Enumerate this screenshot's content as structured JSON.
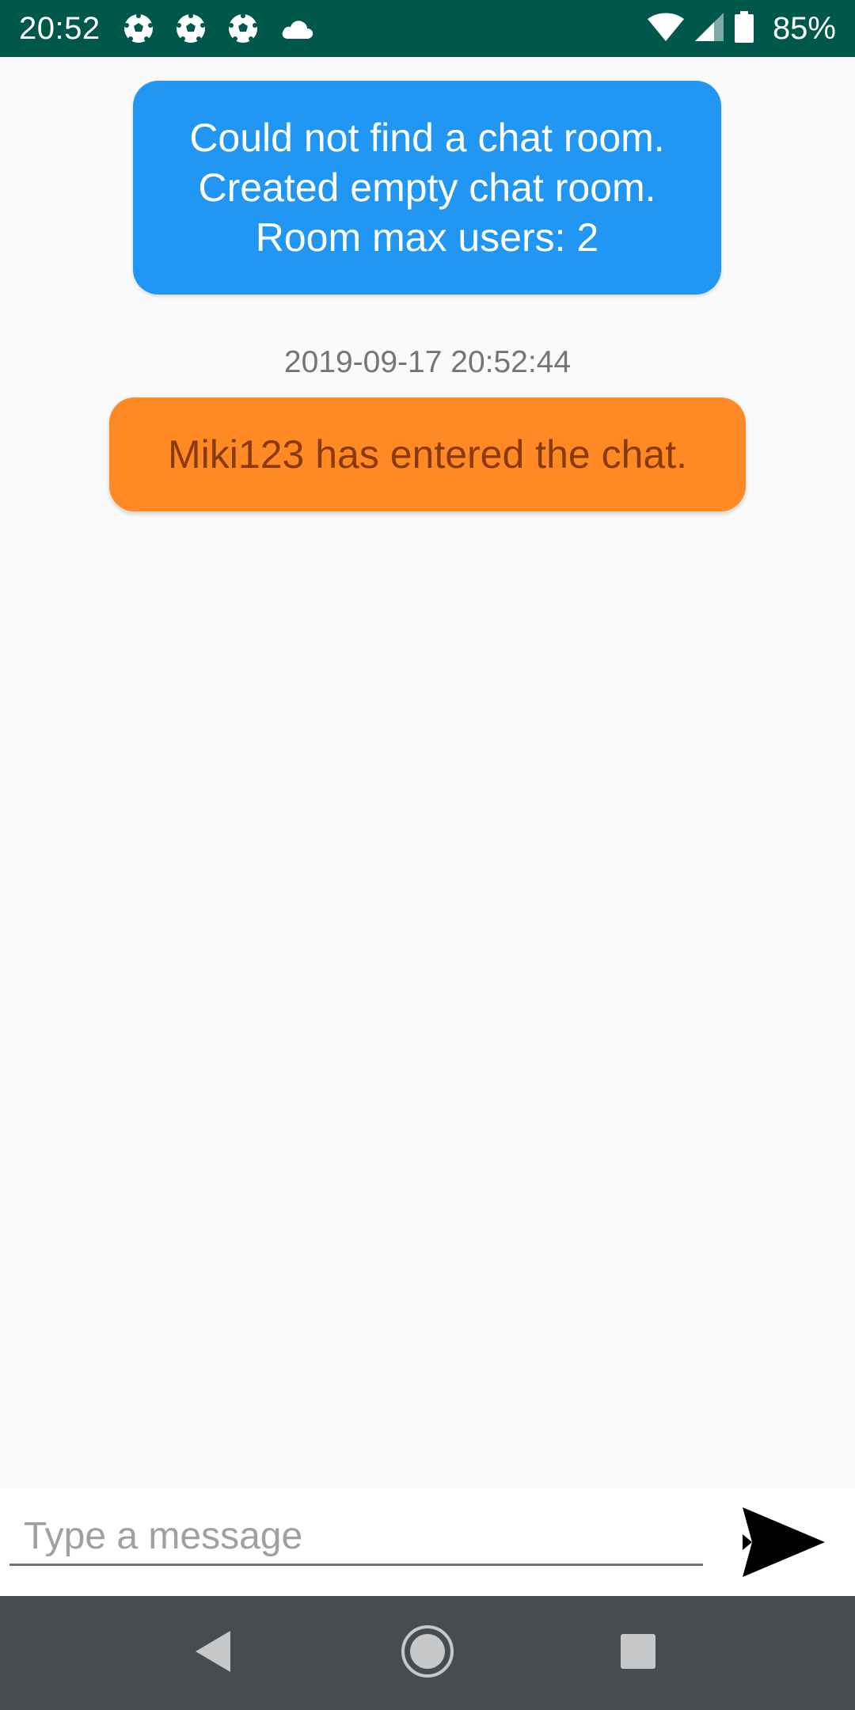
{
  "status_bar": {
    "time": "20:52",
    "battery": "85%",
    "left_icons": [
      "soccer-ball-icon",
      "soccer-ball-icon",
      "soccer-ball-icon",
      "cloud-icon"
    ],
    "right_icons": [
      "wifi-icon",
      "cell-signal-icon",
      "battery-icon"
    ],
    "background_color": "#00574b"
  },
  "chat": {
    "system_message": {
      "lines": [
        "Could not find a chat room.",
        "Created empty chat room.",
        "Room max users: 2"
      ],
      "color": "#2196f3"
    },
    "timestamp": "2019-09-17 20:52:44",
    "join_message": {
      "text": "Miki123 has entered the chat.",
      "color": "#ff8a25"
    }
  },
  "input": {
    "placeholder": "Type a message",
    "value": "",
    "send_icon": "send-icon"
  },
  "nav_bar": {
    "buttons": [
      "back-icon",
      "home-icon",
      "recents-icon"
    ],
    "background_color": "#474c51"
  }
}
